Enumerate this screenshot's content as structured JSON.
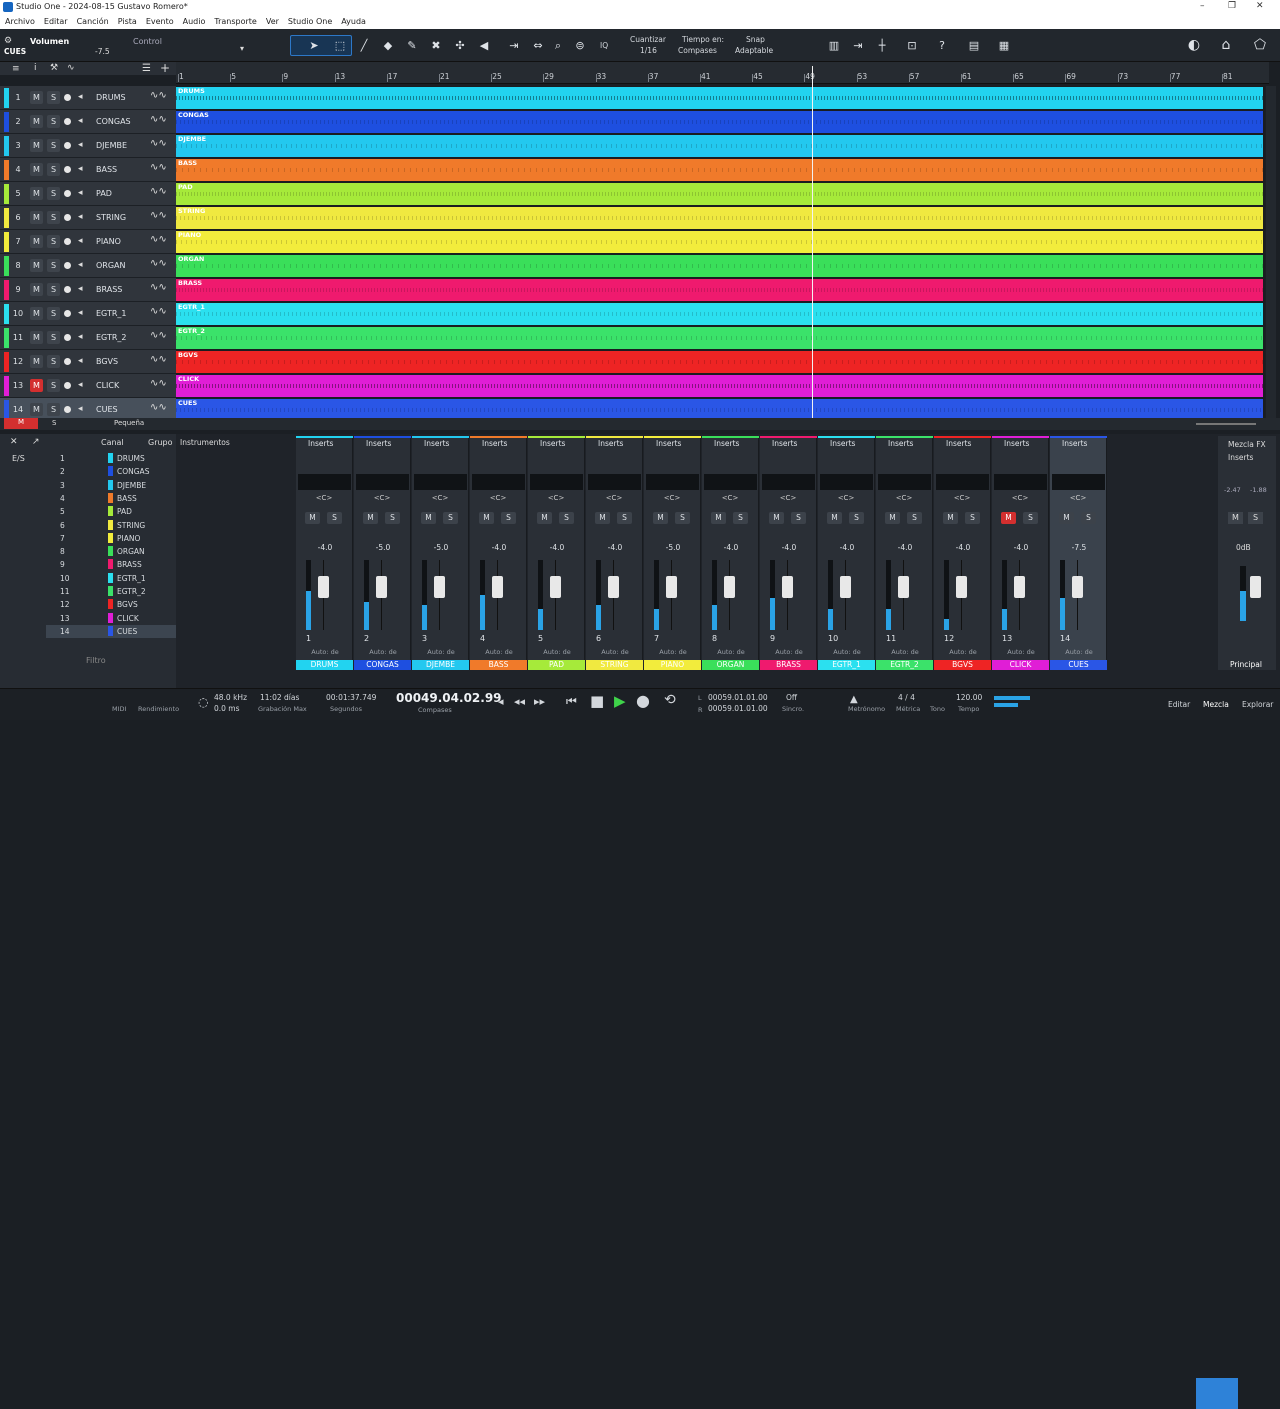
{
  "app": {
    "title": "Studio One - 2024-08-15 Gustavo Romero*"
  },
  "window": {
    "minimize": "–",
    "restore": "❐",
    "close": "✕"
  },
  "menu": [
    "Archivo",
    "Editar",
    "Canción",
    "Pista",
    "Evento",
    "Audio",
    "Transporte",
    "Ver",
    "Studio One",
    "Ayuda"
  ],
  "toolbar": {
    "param_label": "Volumen",
    "param_value": "-7.5",
    "control_label": "Control",
    "track_name": "CUES",
    "iq": "IQ",
    "quantize_label": "Cuantizar",
    "quantize_value": "1/16",
    "timebase_label": "Tiempo en:",
    "timebase_value": "Compases",
    "snap_label": "Snap",
    "snap_value": "Adaptable"
  },
  "ruler": {
    "marks": [
      "1",
      "5",
      "9",
      "13",
      "17",
      "21",
      "25",
      "29",
      "33",
      "37",
      "41",
      "45",
      "49",
      "53",
      "57",
      "61",
      "65",
      "69",
      "73",
      "77",
      "81"
    ]
  },
  "tracks": [
    {
      "num": "1",
      "name": "DRUMS",
      "color": "#22d3f0",
      "muted": false,
      "lane": "DRUMS"
    },
    {
      "num": "2",
      "name": "CONGAS",
      "color": "#1e4fe0",
      "muted": false,
      "lane": "CONGAS"
    },
    {
      "num": "3",
      "name": "DJEMBE",
      "color": "#23c8ef",
      "muted": false,
      "lane": "DJEMBE"
    },
    {
      "num": "4",
      "name": "BASS",
      "color": "#f07a2a",
      "muted": false,
      "lane": "BASS"
    },
    {
      "num": "5",
      "name": "PAD",
      "color": "#a6ea3a",
      "muted": false,
      "lane": "PAD"
    },
    {
      "num": "6",
      "name": "STRING",
      "color": "#f0e940",
      "muted": false,
      "lane": "STRING"
    },
    {
      "num": "7",
      "name": "PIANO",
      "color": "#f2ec3c",
      "muted": false,
      "lane": "PIANO"
    },
    {
      "num": "8",
      "name": "ORGAN",
      "color": "#3adf5a",
      "muted": false,
      "lane": "ORGAN"
    },
    {
      "num": "9",
      "name": "BRASS",
      "color": "#ef1a6e",
      "muted": false,
      "lane": "BRASS"
    },
    {
      "num": "10",
      "name": "EGTR_1",
      "color": "#2be0ef",
      "muted": false,
      "lane": "EGTR_1"
    },
    {
      "num": "11",
      "name": "EGTR_2",
      "color": "#3be26a",
      "muted": false,
      "lane": "EGTR_2"
    },
    {
      "num": "12",
      "name": "BGVS",
      "color": "#ee2424",
      "muted": false,
      "lane": "BGVS"
    },
    {
      "num": "13",
      "name": "CLICK",
      "color": "#e01ed6",
      "muted": true,
      "lane": "CLICK"
    },
    {
      "num": "14",
      "name": "CUES",
      "color": "#2a56e6",
      "muted": false,
      "lane": "CUES"
    }
  ],
  "labels": {
    "m": "M",
    "s": "S",
    "size": "Pequeña",
    "canal": "Canal",
    "grupo": "Grupo",
    "instrumentos": "Instrumentos",
    "es": "E/S",
    "filtro": "Filtro",
    "inserts": "Inserts",
    "pan": "<C>",
    "auto": "Auto: de",
    "mezcla_fx": "Mezcla FX",
    "principal": "Principal",
    "main_db": "0dB",
    "main_l": "-2.47",
    "main_r": "-1.88"
  },
  "mixer": [
    {
      "vol": "-4.0",
      "name": "DRUMS",
      "color": "#22d3f0",
      "level": 0.55,
      "muted": false
    },
    {
      "vol": "-5.0",
      "name": "CONGAS",
      "color": "#1e4fe0",
      "level": 0.4,
      "muted": false
    },
    {
      "vol": "-5.0",
      "name": "DJEMBE",
      "color": "#23c8ef",
      "level": 0.35,
      "muted": false
    },
    {
      "vol": "-4.0",
      "name": "BASS",
      "color": "#f07a2a",
      "level": 0.5,
      "muted": false
    },
    {
      "vol": "-4.0",
      "name": "PAD",
      "color": "#a6ea3a",
      "level": 0.3,
      "muted": false
    },
    {
      "vol": "-4.0",
      "name": "STRING",
      "color": "#f0e940",
      "level": 0.35,
      "muted": false
    },
    {
      "vol": "-5.0",
      "name": "PIANO",
      "color": "#f2ec3c",
      "level": 0.3,
      "muted": false
    },
    {
      "vol": "-4.0",
      "name": "ORGAN",
      "color": "#3adf5a",
      "level": 0.35,
      "muted": false
    },
    {
      "vol": "-4.0",
      "name": "BRASS",
      "color": "#ef1a6e",
      "level": 0.45,
      "muted": false
    },
    {
      "vol": "-4.0",
      "name": "EGTR_1",
      "color": "#2be0ef",
      "level": 0.3,
      "muted": false
    },
    {
      "vol": "-4.0",
      "name": "EGTR_2",
      "color": "#3be26a",
      "level": 0.3,
      "muted": false
    },
    {
      "vol": "-4.0",
      "name": "BGVS",
      "color": "#ee2424",
      "level": 0.15,
      "muted": false
    },
    {
      "vol": "-4.0",
      "name": "CLICK",
      "color": "#e01ed6",
      "level": 0.3,
      "muted": true
    },
    {
      "vol": "-7.5",
      "name": "CUES",
      "color": "#2a56e6",
      "level": 0.45,
      "muted": false
    }
  ],
  "status": {
    "midi": "MIDI",
    "render": "Rendimiento",
    "rate": "48.0 kHz",
    "latency": "0.0 ms",
    "rec_time": "11:02 días",
    "rec_max": "Grabación Max",
    "time": "00:01:37.749",
    "seconds": "Segundos",
    "position": "00049.04.02.99",
    "compases": "Compases",
    "loop_l": "L",
    "loop_r": "R",
    "loop_start": "00059.01.01.00",
    "loop_end": "00059.01.01.00",
    "sync_state": "Off",
    "sync": "Sincro.",
    "metronome": "Metrónomo",
    "sig": "4 / 4",
    "sig_label": "Métrica",
    "tono": "Tono",
    "tempo": "120.00",
    "tempo_label": "Tempo",
    "edit": "Editar",
    "mix": "Mezcla",
    "browse": "Explorar"
  }
}
